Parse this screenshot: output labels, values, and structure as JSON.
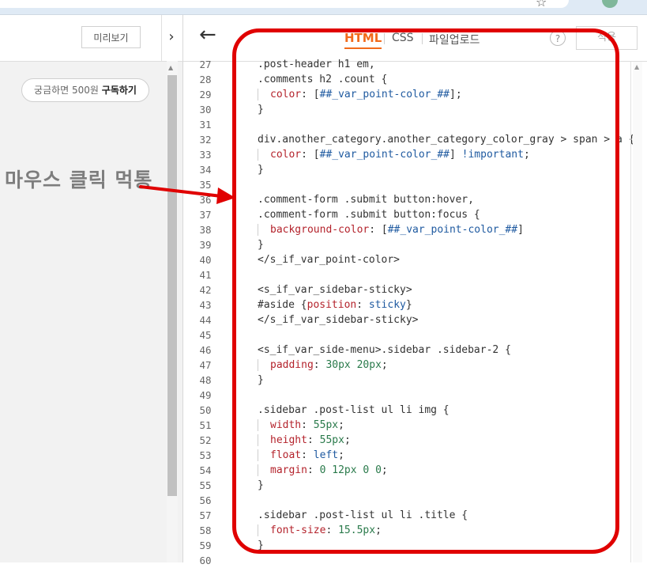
{
  "left_panel": {
    "preview_label": "미리보기",
    "collapse_glyph": "›",
    "subscribe_prefix": "궁금하면 500원 ",
    "subscribe_action": "구독하기"
  },
  "annotation": {
    "text": "마우스 클릭 먹통"
  },
  "editor": {
    "back_glyph": "←",
    "tabs": {
      "html": "HTML",
      "css": "CSS",
      "upload": "파일업로드"
    },
    "help_label": "?",
    "apply_label": "적용",
    "accent_color": "#f26a1b",
    "lines": [
      {
        "num": "27",
        "segments": [
          {
            "t": ".post-header h1 em,",
            "c": "sel"
          }
        ]
      },
      {
        "num": "28",
        "segments": [
          {
            "t": ".comments h2 .count {",
            "c": "sel"
          }
        ]
      },
      {
        "num": "29",
        "indent": true,
        "segments": [
          {
            "t": "color",
            "c": "prop"
          },
          {
            "t": ": [",
            "c": "sel"
          },
          {
            "t": "##_var_point-color_##",
            "c": "var"
          },
          {
            "t": "];",
            "c": "sel"
          }
        ]
      },
      {
        "num": "30",
        "segments": [
          {
            "t": "}",
            "c": "sel"
          }
        ]
      },
      {
        "num": "31",
        "segments": []
      },
      {
        "num": "32",
        "segments": [
          {
            "t": "div.another_category.another_category_color_gray > span > a {",
            "c": "sel"
          }
        ]
      },
      {
        "num": "33",
        "indent": true,
        "segments": [
          {
            "t": "color",
            "c": "prop"
          },
          {
            "t": ": [",
            "c": "sel"
          },
          {
            "t": "##_var_point-color_##",
            "c": "var"
          },
          {
            "t": "] ",
            "c": "sel"
          },
          {
            "t": "!important",
            "c": "val"
          },
          {
            "t": ";",
            "c": "sel"
          }
        ]
      },
      {
        "num": "34",
        "segments": [
          {
            "t": "}",
            "c": "sel"
          }
        ]
      },
      {
        "num": "35",
        "segments": []
      },
      {
        "num": "36",
        "segments": [
          {
            "t": ".comment-form .submit button:hover,",
            "c": "sel"
          }
        ]
      },
      {
        "num": "37",
        "segments": [
          {
            "t": ".comment-form .submit button:focus {",
            "c": "sel"
          }
        ]
      },
      {
        "num": "38",
        "indent": true,
        "segments": [
          {
            "t": "background-color",
            "c": "prop"
          },
          {
            "t": ": [",
            "c": "sel"
          },
          {
            "t": "##_var_point-color_##",
            "c": "var"
          },
          {
            "t": "]",
            "c": "sel"
          }
        ]
      },
      {
        "num": "39",
        "segments": [
          {
            "t": "}",
            "c": "sel"
          }
        ]
      },
      {
        "num": "40",
        "segments": [
          {
            "t": "</s_if_var_point-color>",
            "c": "tag"
          }
        ]
      },
      {
        "num": "41",
        "segments": []
      },
      {
        "num": "42",
        "segments": [
          {
            "t": "<s_if_var_sidebar-sticky>",
            "c": "tag"
          }
        ]
      },
      {
        "num": "43",
        "segments": [
          {
            "t": "#aside {",
            "c": "sel"
          },
          {
            "t": "position",
            "c": "prop"
          },
          {
            "t": ": ",
            "c": "sel"
          },
          {
            "t": "sticky",
            "c": "val"
          },
          {
            "t": "}",
            "c": "sel"
          }
        ]
      },
      {
        "num": "44",
        "segments": [
          {
            "t": "</s_if_var_sidebar-sticky>",
            "c": "tag"
          }
        ]
      },
      {
        "num": "45",
        "segments": []
      },
      {
        "num": "46",
        "segments": [
          {
            "t": "<s_if_var_side-menu>.sidebar .sidebar-2 {",
            "c": "tag"
          }
        ]
      },
      {
        "num": "47",
        "indent": true,
        "segments": [
          {
            "t": "padding",
            "c": "prop"
          },
          {
            "t": ": ",
            "c": "sel"
          },
          {
            "t": "30px 20px",
            "c": "num"
          },
          {
            "t": ";",
            "c": "sel"
          }
        ]
      },
      {
        "num": "48",
        "segments": [
          {
            "t": "}",
            "c": "sel"
          }
        ]
      },
      {
        "num": "49",
        "segments": []
      },
      {
        "num": "50",
        "segments": [
          {
            "t": ".sidebar .post-list ul li img {",
            "c": "sel"
          }
        ]
      },
      {
        "num": "51",
        "indent": true,
        "segments": [
          {
            "t": "width",
            "c": "prop"
          },
          {
            "t": ": ",
            "c": "sel"
          },
          {
            "t": "55px",
            "c": "num"
          },
          {
            "t": ";",
            "c": "sel"
          }
        ]
      },
      {
        "num": "52",
        "indent": true,
        "segments": [
          {
            "t": "height",
            "c": "prop"
          },
          {
            "t": ": ",
            "c": "sel"
          },
          {
            "t": "55px",
            "c": "num"
          },
          {
            "t": ";",
            "c": "sel"
          }
        ]
      },
      {
        "num": "53",
        "indent": true,
        "segments": [
          {
            "t": "float",
            "c": "prop"
          },
          {
            "t": ": ",
            "c": "sel"
          },
          {
            "t": "left",
            "c": "val"
          },
          {
            "t": ";",
            "c": "sel"
          }
        ]
      },
      {
        "num": "54",
        "indent": true,
        "segments": [
          {
            "t": "margin",
            "c": "prop"
          },
          {
            "t": ": ",
            "c": "sel"
          },
          {
            "t": "0 12px 0 0",
            "c": "num"
          },
          {
            "t": ";",
            "c": "sel"
          }
        ]
      },
      {
        "num": "55",
        "segments": [
          {
            "t": "}",
            "c": "sel"
          }
        ]
      },
      {
        "num": "56",
        "segments": []
      },
      {
        "num": "57",
        "segments": [
          {
            "t": ".sidebar .post-list ul li .title {",
            "c": "sel"
          }
        ]
      },
      {
        "num": "58",
        "indent": true,
        "segments": [
          {
            "t": "font-size",
            "c": "prop"
          },
          {
            "t": ": ",
            "c": "sel"
          },
          {
            "t": "15.5px",
            "c": "num"
          },
          {
            "t": ";",
            "c": "sel"
          }
        ]
      },
      {
        "num": "59",
        "segments": [
          {
            "t": "}",
            "c": "sel"
          }
        ]
      },
      {
        "num": "60",
        "segments": []
      }
    ]
  },
  "icons": {
    "star": "star-icon",
    "profile": "profile-avatar-icon",
    "back": "back-arrow-icon",
    "help": "help-icon"
  },
  "colors": {
    "annotation_red": "#e00000",
    "tab_active": "#f26a1b"
  }
}
